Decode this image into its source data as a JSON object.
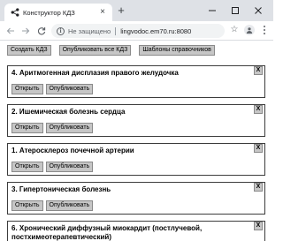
{
  "browser": {
    "tab": {
      "title": "Конструктор КДЗ",
      "icon": "share-nodes-icon"
    },
    "new_tab_label": "+",
    "window_controls": {
      "minimize": "minimize-icon",
      "maximize": "maximize-icon",
      "close": "close-icon"
    },
    "address_bar": {
      "security_text": "Не защищено",
      "url": "lingvodoc.em70.ru:8080"
    }
  },
  "page": {
    "actions": [
      {
        "label": "Создать КДЗ"
      },
      {
        "label": "Опубликовать все КДЗ"
      },
      {
        "label": "Шаблоны справочников"
      }
    ],
    "cards": [
      {
        "title": "4. Аритмогенная дисплазия правого желудочка",
        "open_label": "Открыть",
        "publish_label": "Опубликовать",
        "close_label": "X"
      },
      {
        "title": "2. Ишемическая болезнь сердца",
        "open_label": "Открыть",
        "publish_label": "Опубликовать",
        "close_label": "X"
      },
      {
        "title": "1. Атеросклероз почечной артерии",
        "open_label": "Открыть",
        "publish_label": "Опубликовать",
        "close_label": "X"
      },
      {
        "title": "3. Гипертоническая болезнь",
        "open_label": "Открыть",
        "publish_label": "Опубликовать",
        "close_label": "X"
      },
      {
        "title": "6. Хронический диффузный миокардит (постлучевой, постхимеотерапевтический)",
        "close_label": "X"
      }
    ]
  },
  "colors": {
    "button_bg": "#c6c6c6",
    "tabbar_bg": "#dee1e6",
    "omnibox_bg": "#f1f3f4"
  }
}
